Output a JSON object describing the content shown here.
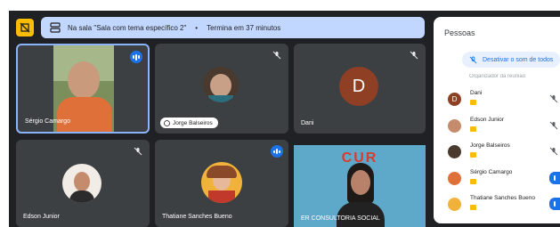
{
  "banner": {
    "room_text": "Na sala \"Sala com tema específico 2\"",
    "separator": "•",
    "time_text": "Termina em 37 minutos"
  },
  "tiles": [
    {
      "name": "Sérgio Camargo"
    },
    {
      "name": "Jorge Balseiros"
    },
    {
      "name": "Dani",
      "initial": "D"
    },
    {
      "name": "Edson Junior"
    },
    {
      "name": "Thatiane Sanches Bueno"
    },
    {
      "name": "ER CONSULTORIA SOCIAL",
      "banner_text": "CUR"
    }
  ],
  "people_panel": {
    "title": "Pessoas",
    "mute_all_label": "Desativar o som de todos",
    "cut_text": "Organizador da reunião",
    "people": [
      {
        "name": "Dani",
        "initial": "D"
      },
      {
        "name": "Edson Junior"
      },
      {
        "name": "Jorge Balseiros"
      },
      {
        "name": "Sérgio Camargo"
      },
      {
        "name": "Thatiane Sanches Bueno"
      }
    ]
  },
  "colors": {
    "accent": "#1a73e8",
    "tile_bg": "#3c4043",
    "room_banner": "#c2d7ff",
    "layout_button": "#fbbc04",
    "dani_avatar": "#8e3f24"
  }
}
